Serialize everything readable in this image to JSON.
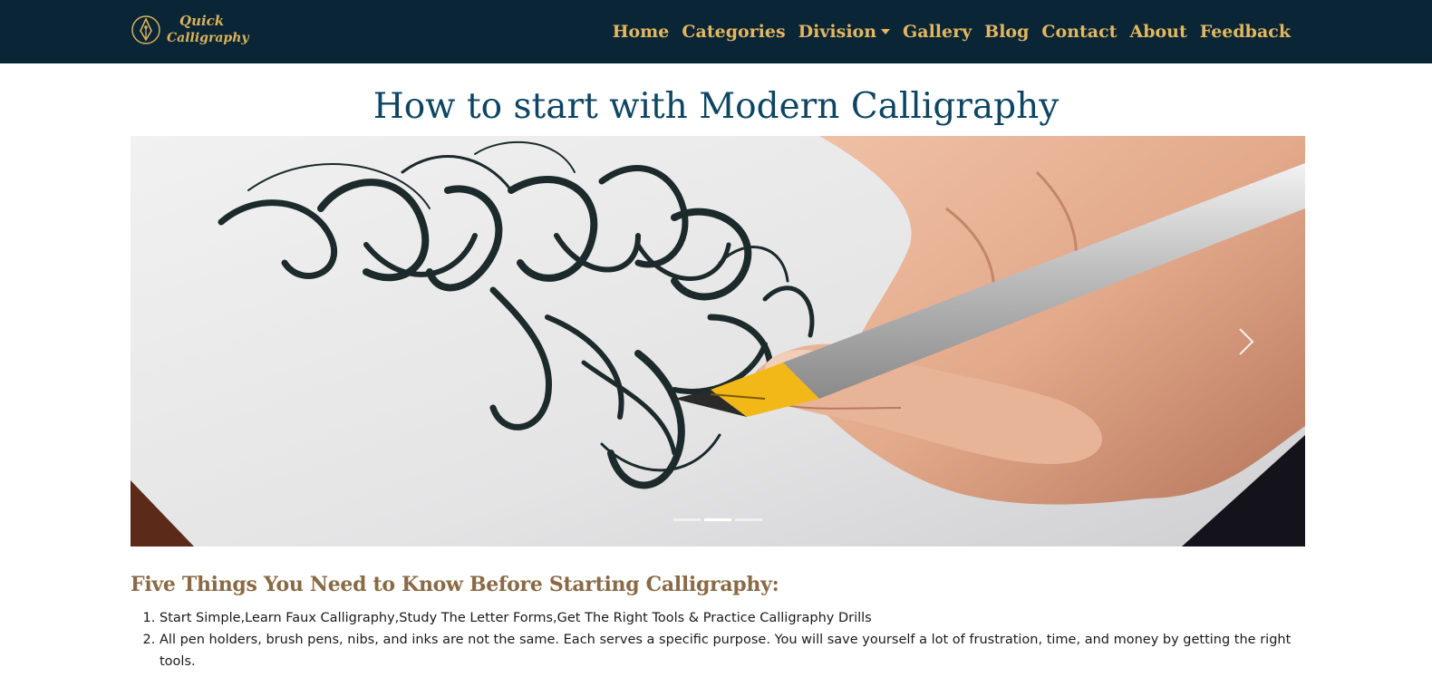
{
  "brand": {
    "line1": "Quick",
    "line2": "Calligraphy",
    "icon": "pen-nib-icon",
    "color": "#d9b25a"
  },
  "nav": {
    "background": "#0a2536",
    "link_color": "#e3b75e",
    "items": [
      {
        "label": "Home"
      },
      {
        "label": "Categories"
      },
      {
        "label": "Division",
        "dropdown": true
      },
      {
        "label": "Gallery"
      },
      {
        "label": "Blog"
      },
      {
        "label": "Contact"
      },
      {
        "label": "About"
      },
      {
        "label": "Feedback"
      }
    ]
  },
  "page": {
    "title": "How to start with Modern Calligraphy",
    "title_color": "#0e4563"
  },
  "carousel": {
    "slide_description_icon": "calligraphy-pen-writing-image",
    "next_icon": "chevron-right-icon",
    "indicators": [
      {
        "active": false
      },
      {
        "active": true
      },
      {
        "active": false
      }
    ]
  },
  "content": {
    "heading": "Five Things You Need to Know Before Starting Calligraphy:",
    "heading_color": "#8a6a45",
    "items": [
      "Start Simple,Learn Faux Calligraphy,Study The Letter Forms,Get The Right Tools & Practice Calligraphy Drills",
      "All pen holders, brush pens, nibs, and inks are not the same. Each serves a specific purpose. You will save yourself a lot of frustration, time, and money by getting the right tools."
    ]
  }
}
